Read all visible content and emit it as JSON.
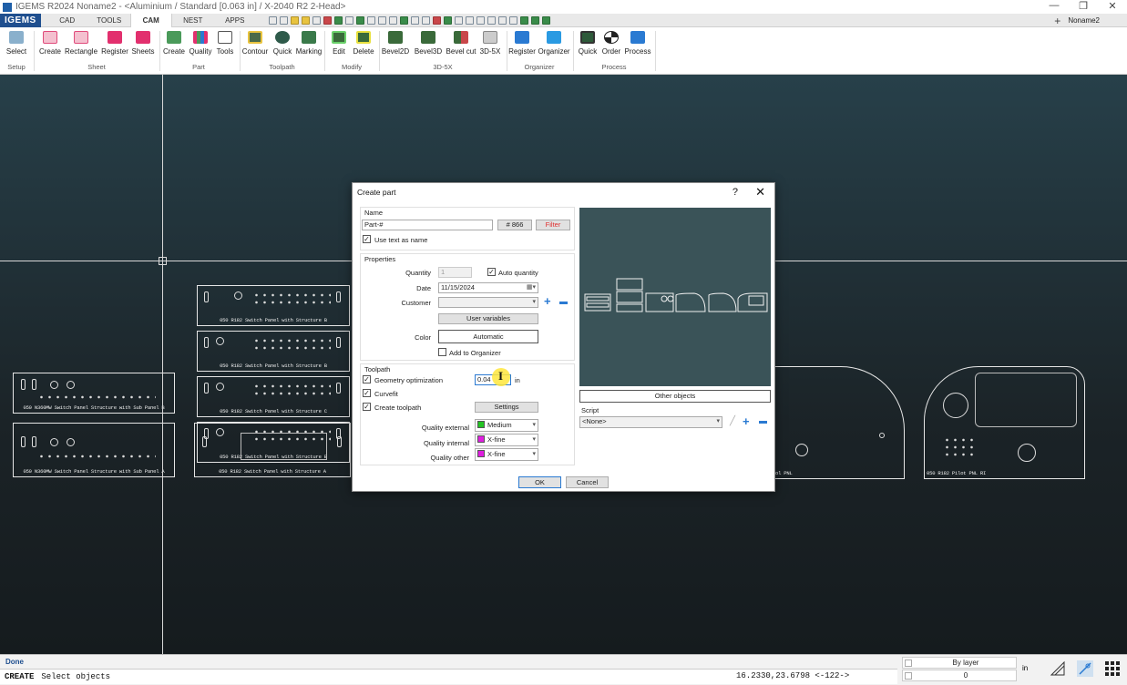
{
  "window": {
    "title": "IGEMS R2024  Noname2 - <Aluminium / Standard [0.063 in] / X-2040 R2 2-Head>",
    "doc_name": "Noname2",
    "controls": [
      "—",
      "❐",
      "✕"
    ]
  },
  "tabs": {
    "logo": "IGEMS",
    "items": [
      "CAD",
      "TOOLS",
      "CAM",
      "NEST",
      "APPS"
    ],
    "active": "CAM"
  },
  "ribbon": {
    "groups": [
      {
        "label": "Setup",
        "buttons": [
          "Select"
        ]
      },
      {
        "label": "Sheet",
        "buttons": [
          "Create",
          "Rectangle",
          "Register",
          "Sheets"
        ]
      },
      {
        "label": "Part",
        "buttons": [
          "Create",
          "Quality",
          "Tools"
        ]
      },
      {
        "label": "Toolpath",
        "buttons": [
          "Contour",
          "Quick",
          "Marking"
        ]
      },
      {
        "label": "Modify",
        "buttons": [
          "Edit",
          "Delete"
        ]
      },
      {
        "label": "3D-5X",
        "buttons": [
          "Bevel2D",
          "Bevel3D",
          "Bevel cut",
          "3D-5X"
        ]
      },
      {
        "label": "Organizer",
        "buttons": [
          "Register",
          "Organizer"
        ]
      },
      {
        "label": "Process",
        "buttons": [
          "Quick",
          "Order",
          "Process"
        ]
      }
    ]
  },
  "canvas_parts": [
    "050 R182 Switch Panel with Structure B",
    "050 R182 Switch Panel with Structure B",
    "050 R182 Switch Panel with Structure C",
    "050 R182 Switch Panel with Structure B",
    "050 R182 Switch Panel with Structure A",
    "050 N360MW Switch Panel Structure with Sub Panel B",
    "050 N360MW Switch Panel Structure with Sub Panel A",
    "ol PNL",
    "050 R182 Pilot PNL RI"
  ],
  "dialog": {
    "title": "Create part",
    "help": "?",
    "close": "✕",
    "name_section": {
      "legend": "Name",
      "value": "Part-#",
      "counter": "# 866",
      "filter_label": "Filter",
      "use_text_label": "Use text as name"
    },
    "properties": {
      "legend": "Properties",
      "quantity_label": "Quantity",
      "quantity_value": "1",
      "auto_quantity_label": "Auto quantity",
      "date_label": "Date",
      "date_value": "11/15/2024",
      "customer_label": "Customer",
      "customer_value": "",
      "user_variables_label": "User variables",
      "color_label": "Color",
      "color_value": "Automatic",
      "add_to_organizer_label": "Add to Organizer"
    },
    "toolpath": {
      "legend": "Toolpath",
      "geometry_opt_label": "Geometry optimization",
      "geometry_opt_value": "0.04",
      "geometry_opt_unit": "in",
      "curvefit_label": "Curvefit",
      "create_toolpath_label": "Create toolpath",
      "settings_label": "Settings",
      "quality_external_label": "Quality external",
      "quality_external_value": "Medium",
      "quality_external_color": "#22c322",
      "quality_internal_label": "Quality internal",
      "quality_internal_value": "X-fine",
      "quality_internal_color": "#e01ee0",
      "quality_other_label": "Quality other",
      "quality_other_value": "X-fine",
      "quality_other_color": "#e01ee0"
    },
    "other_objects_label": "Other objects",
    "script_label": "Script",
    "script_value": "<None>",
    "ok_label": "OK",
    "cancel_label": "Cancel"
  },
  "status": {
    "state": "Done",
    "command": "CREATE",
    "prompt": "Select objects",
    "coords": "16.2330,23.6798 <-122->",
    "layer": "By layer",
    "layer_num": "0",
    "units": "in"
  }
}
